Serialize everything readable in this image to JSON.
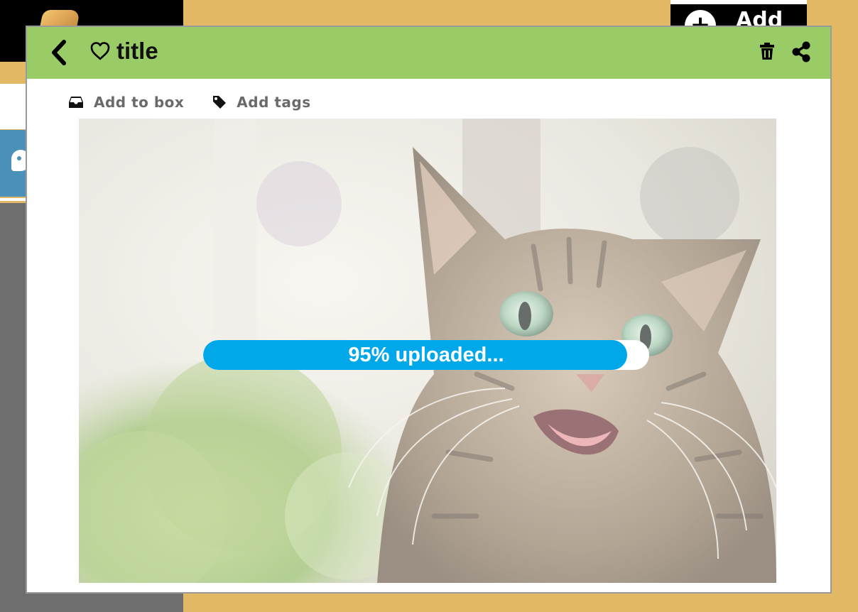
{
  "background": {
    "add_button_label": "Add",
    "add_icon": "plus-circle-icon",
    "palette_icon": "palette-icon"
  },
  "modal": {
    "title": "title",
    "back_icon": "chevron-left-icon",
    "favorite_icon": "heart-outline-icon",
    "delete_icon": "trash-icon",
    "share_icon": "share-icon",
    "header_color": "#99cc66"
  },
  "toolbar": {
    "add_to_box_label": "Add to box",
    "add_to_box_icon": "inbox-icon",
    "add_tags_label": "Add tags",
    "add_tags_icon": "tag-icon"
  },
  "upload": {
    "progress_percent": 95,
    "status_text": "95% uploaded...",
    "bar_color": "#00a8ea"
  }
}
